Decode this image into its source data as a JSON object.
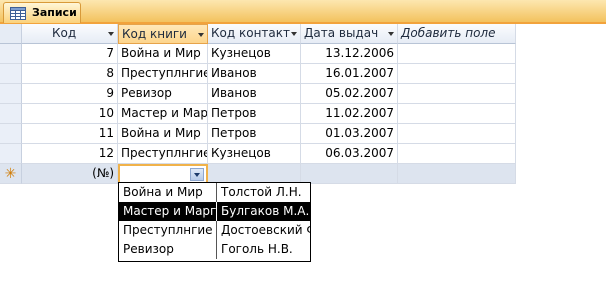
{
  "tab": {
    "label": "Записи",
    "icon": "table-icon"
  },
  "table": {
    "columns": [
      "Код",
      "Код книги",
      "Код контакт",
      "Дата выдач",
      "Добавить поле"
    ],
    "rows": [
      [
        "7",
        "Война и Мир",
        "Кузнецов",
        "13.12.2006"
      ],
      [
        "8",
        "Преступлнгие",
        "Иванов",
        "16.01.2007"
      ],
      [
        "9",
        "Ревизор",
        "Иванов",
        "05.02.2007"
      ],
      [
        "10",
        "Мастер и Мар",
        "Петров",
        "11.02.2007"
      ],
      [
        "11",
        "Война и Мир",
        "Петров",
        "01.03.2007"
      ],
      [
        "12",
        "Преступлнгие",
        "Кузнецов",
        "06.03.2007"
      ]
    ],
    "new_row": {
      "marker": "✳",
      "counter": "(№)"
    }
  },
  "dropdown": {
    "items": [
      [
        "Война и Мир",
        "Толстой Л.Н."
      ],
      [
        "Мастер и Марг",
        "Булгаков М.А."
      ],
      [
        "Преступлнгие",
        "Достоевский Ф"
      ],
      [
        "Ревизор",
        "Гоголь Н.В."
      ]
    ],
    "selected_index": 1
  },
  "colors": {
    "accent": "#f2a33c",
    "grid_line": "#d5dbe6",
    "selection": "#000000"
  }
}
